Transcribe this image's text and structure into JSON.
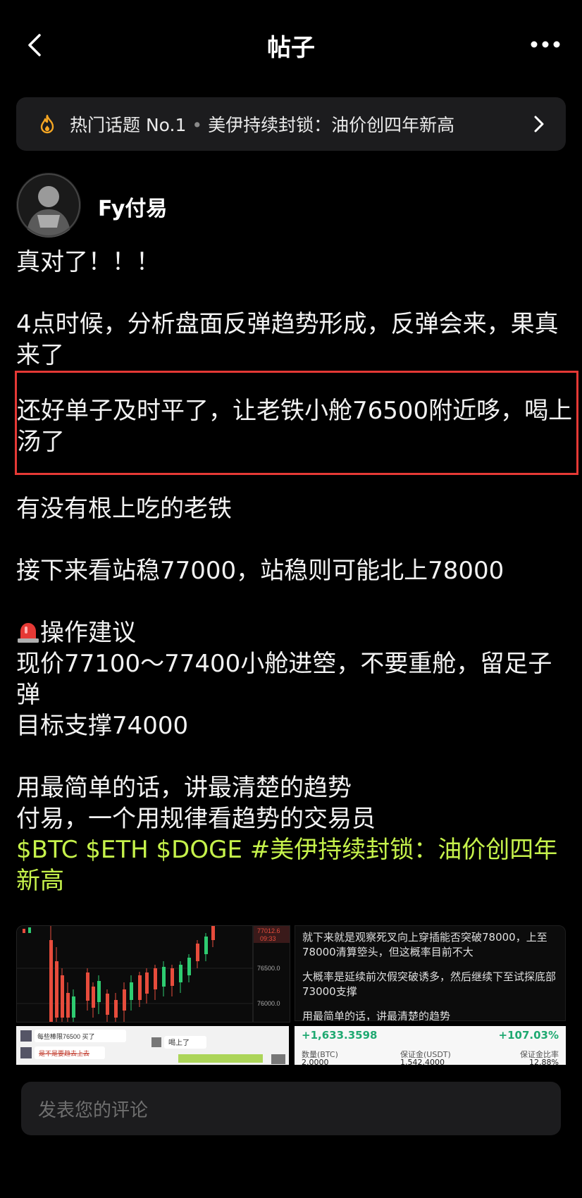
{
  "header": {
    "title": "帖子",
    "back_icon": "chevron-left-icon",
    "more_icon": "more-horizontal-icon"
  },
  "topic": {
    "icon": "fire-icon",
    "rank": "热门话题 No.1",
    "separator": "•",
    "title": "美伊持续封锁：油价创四年新高",
    "arrow_icon": "chevron-right-icon"
  },
  "author": {
    "name": "Fy付易"
  },
  "post": {
    "line1": "真对了！！！",
    "para2": "4点时候，分析盘面反弹趋势形成，反弹会来，果真来了",
    "para3": "还好单子及时平了，让老铁小舱76500附近哆，喝上汤了",
    "para4": "有没有根上吃的老铁",
    "para5": "接下来看站稳77000，站稳则可能北上78000",
    "advice_icon": "siren-icon",
    "advice_title": "操作建议",
    "advice_line1": "现价77100～77400小舱进箜，不要重舱，留足子弹",
    "advice_line2": "目标支撑74000",
    "sign1": "用最简单的话，讲最清楚的趋势",
    "sign2": "付易，一个用规律看趋势的交易员",
    "tags": "$BTC $ETH $DOGE #美伊持续封锁：油价创四年新高"
  },
  "images": {
    "chart": {
      "price_top": "77012.6",
      "time": "09:33",
      "price_mid": "76500.0",
      "price_low": "76000.0"
    },
    "text_image": {
      "para1": "就下来就是观察死叉向上穿插能否突破78000，上至78000清算箜头，但这概率目前不大",
      "para2": "大概率是延续前次假突破诱多，然后继续下至试探底部73000支撑",
      "para3": "用最简单的话，讲最清楚的趋势"
    },
    "chat": {
      "msg1": "每些棒限76500 买了 ",
      "msg2": "喝上了",
      "msg3": "是不是要趋去上去"
    },
    "trade": {
      "pnl": "+1,633.3598",
      "pnl_pct": "+107.03%",
      "col1_label": "数量(BTC)",
      "col2_label": "保证金(USDT)",
      "col3_label": "保证金比率",
      "col1_value": "2.0000",
      "col2_value": "1,542.4000",
      "col3_value": "12.88%"
    }
  },
  "comment": {
    "placeholder": "发表您的评论"
  },
  "colors": {
    "background": "#000000",
    "tag_green": "#c6f24b",
    "highlight_red": "#e53935",
    "banner_bg": "#1c1c1e",
    "fire_orange": "#f5a623"
  }
}
